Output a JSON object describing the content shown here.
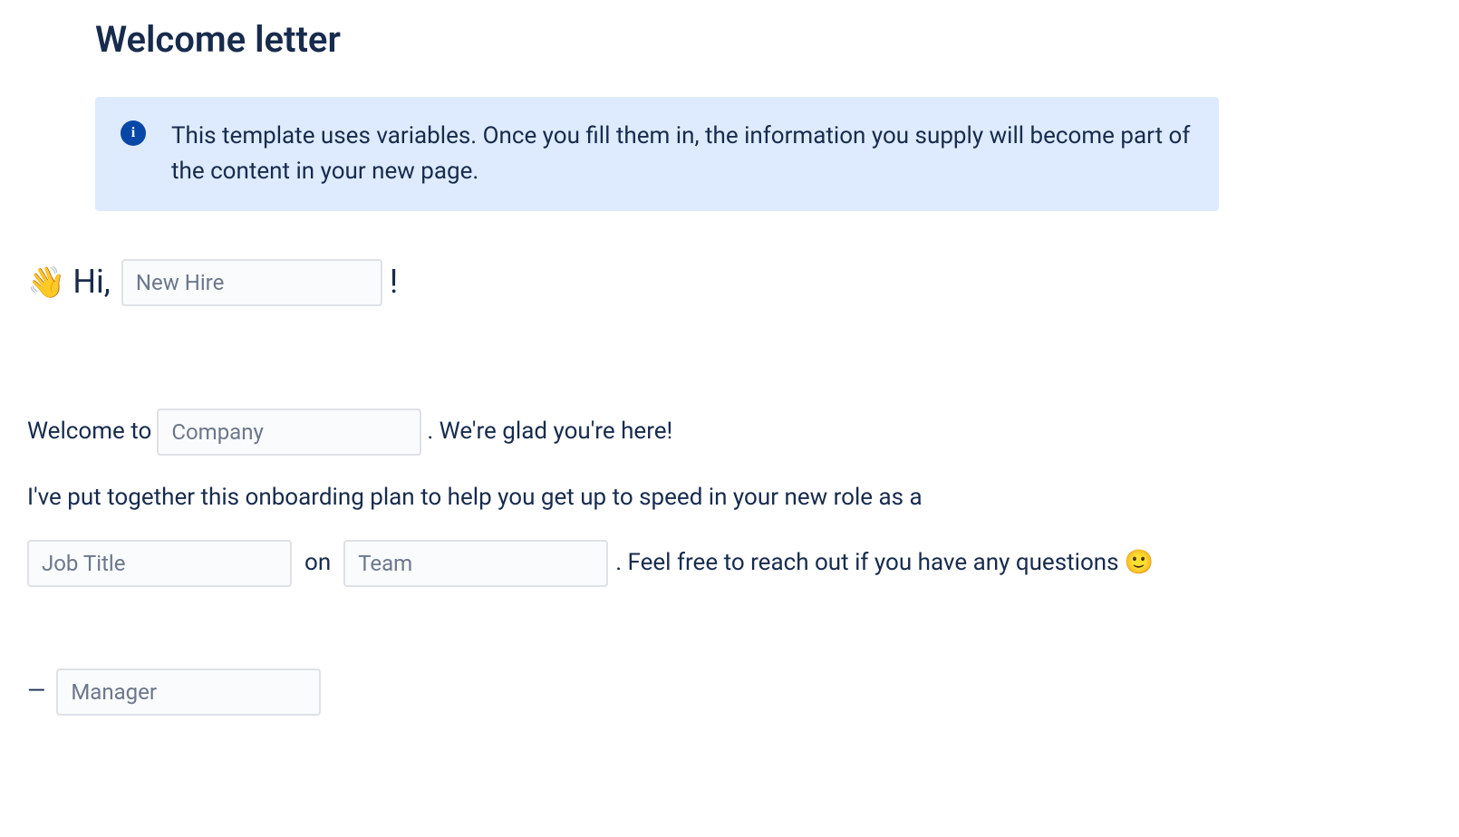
{
  "page": {
    "title": "Welcome letter"
  },
  "info": {
    "text": "This template uses variables. Once you fill them in, the information you supply will become part of the content in your new page."
  },
  "greeting": {
    "wave_emoji": "👋",
    "hi": "Hi,",
    "newhire_placeholder": "New Hire",
    "exclaim": "!"
  },
  "body": {
    "welcome_prefix": "Welcome to",
    "company_placeholder": "Company",
    "welcome_suffix": ". We're glad you're here!",
    "line2": "I've put together this onboarding plan to help you get up to speed in your new role as a",
    "jobtitle_placeholder": "Job Title",
    "on_text": "on",
    "team_placeholder": "Team",
    "line3_suffix": ". Feel free to reach out if you have any questions",
    "smiley": "🙂"
  },
  "signature": {
    "dash": "—",
    "manager_placeholder": "Manager"
  }
}
